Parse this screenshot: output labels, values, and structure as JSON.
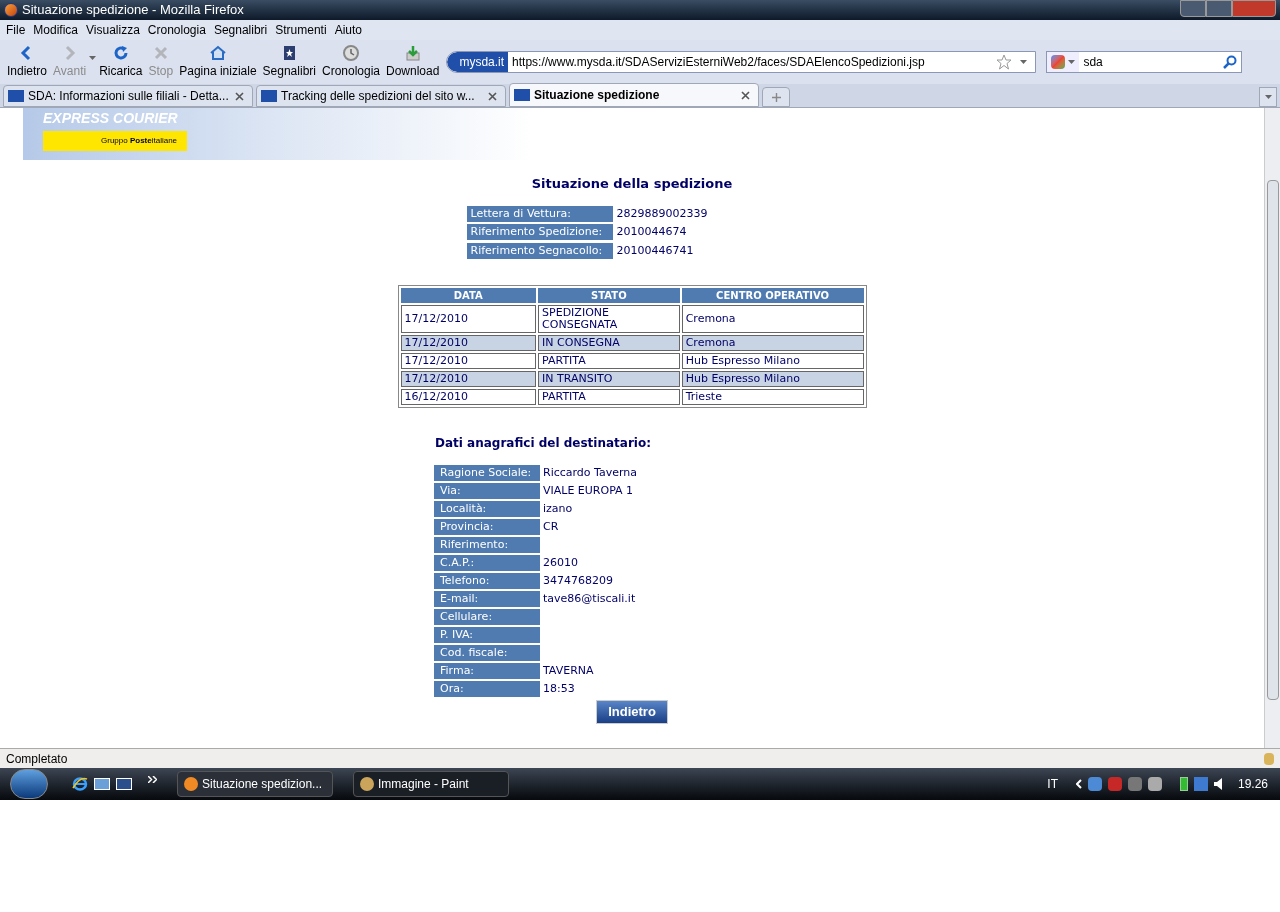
{
  "window": {
    "title": "Situazione spedizione - Mozilla Firefox"
  },
  "menu": [
    "File",
    "Modifica",
    "Visualizza",
    "Cronologia",
    "Segnalibri",
    "Strumenti",
    "Aiuto"
  ],
  "toolbar": [
    {
      "label": "Indietro",
      "kind": "back",
      "disabled": false
    },
    {
      "label": "Avanti",
      "kind": "forward",
      "disabled": true
    },
    {
      "label": "Ricarica",
      "kind": "reload",
      "disabled": false
    },
    {
      "label": "Stop",
      "kind": "stop",
      "disabled": true
    },
    {
      "label": "Pagina iniziale",
      "kind": "home",
      "disabled": false
    },
    {
      "label": "Segnalibri",
      "kind": "bookmarks",
      "disabled": false
    },
    {
      "label": "Cronologia",
      "kind": "history",
      "disabled": false
    },
    {
      "label": "Download",
      "kind": "download",
      "disabled": false
    }
  ],
  "address": {
    "site": "mysda.it",
    "url": "https://www.mysda.it/SDAServiziEsterniWeb2/faces/SDAElencoSpedizioni.jsp"
  },
  "search": {
    "value": "sda"
  },
  "tabs": [
    {
      "label": "SDA: Informazioni sulle filiali - Detta...",
      "selected": false
    },
    {
      "label": "Tracking delle spedizioni del sito w...",
      "selected": false
    },
    {
      "label": "Situazione spedizione",
      "selected": true
    }
  ],
  "banner": {
    "title": "EXPRESS COURIER",
    "group": "Gruppo **Poste**italiane"
  },
  "heading": "Situazione della spedizione",
  "info": [
    {
      "label": "Lettera di Vettura:",
      "value": "2829889002339"
    },
    {
      "label": "Riferimento Spedizione:",
      "value": "2010044674"
    },
    {
      "label": "Riferimento Segnacollo:",
      "value": "20100446741"
    }
  ],
  "table": {
    "columns": [
      "DATA",
      "STATO",
      "CENTRO OPERATIVO"
    ],
    "rows": [
      [
        "17/12/2010",
        "SPEDIZIONE CONSEGNATA",
        "Cremona"
      ],
      [
        "17/12/2010",
        "IN CONSEGNA",
        "Cremona"
      ],
      [
        "17/12/2010",
        "PARTITA",
        "Hub Espresso Milano"
      ],
      [
        "17/12/2010",
        "IN TRANSITO",
        "Hub Espresso Milano"
      ],
      [
        "16/12/2010",
        "PARTITA",
        "Trieste"
      ]
    ]
  },
  "recipient": {
    "heading": "Dati anagrafici del destinatario:",
    "fields": [
      {
        "label": "Ragione Sociale:",
        "value": "Riccardo Taverna"
      },
      {
        "label": "Via:",
        "value": "VIALE EUROPA 1"
      },
      {
        "label": "Località:",
        "value": "izano"
      },
      {
        "label": "Provincia:",
        "value": "CR"
      },
      {
        "label": "Riferimento:"
      },
      {
        "label": "C.A.P.:",
        "value": "26010"
      },
      {
        "label": "Telefono:",
        "value": "3474768209"
      },
      {
        "label": "E-mail:",
        "value": "tave86@tiscali.it"
      },
      {
        "label": "Cellulare:"
      },
      {
        "label": "P. IVA:"
      },
      {
        "label": "Cod. fiscale:"
      },
      {
        "label": "Firma:",
        "value": "TAVERNA"
      },
      {
        "label": "Ora:",
        "value": "18:53"
      }
    ]
  },
  "back_button": "Indietro",
  "status_bar": "Completato",
  "taskbar": {
    "items": [
      {
        "label": "Situazione spedizion...",
        "selected": true
      },
      {
        "label": "Immagine - Paint",
        "selected": false
      }
    ],
    "language": "IT",
    "clock": "19.26"
  }
}
